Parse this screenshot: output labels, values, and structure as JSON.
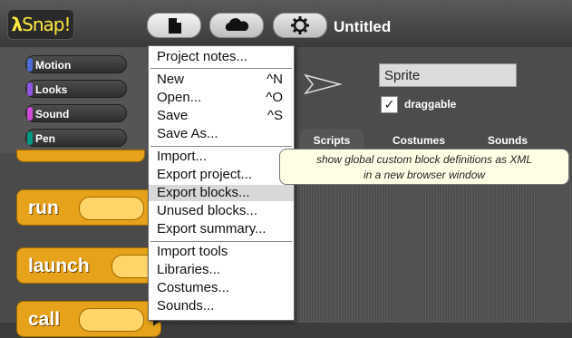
{
  "app": {
    "logo": "Snap!",
    "title": "Untitled"
  },
  "toolbar": {
    "file_icon": "file-icon",
    "cloud_icon": "cloud-icon",
    "settings_icon": "gear-icon"
  },
  "categories": [
    {
      "label": "Motion",
      "color": "#4a6cd4"
    },
    {
      "label": "Looks",
      "color": "#8f56e3"
    },
    {
      "label": "Sound",
      "color": "#cf4ad9"
    },
    {
      "label": "Pen",
      "color": "#009982"
    }
  ],
  "palette": {
    "blocks": [
      "run",
      "launch",
      "call"
    ]
  },
  "sprite": {
    "name": "Sprite",
    "draggable_label": "draggable",
    "draggable_checked": "✓"
  },
  "tabs": [
    "Scripts",
    "Costumes",
    "Sounds"
  ],
  "file_menu": {
    "items": [
      {
        "label": "Project notes...",
        "shortcut": ""
      },
      {
        "label": "New",
        "shortcut": "^N"
      },
      {
        "label": "Open...",
        "shortcut": "^O"
      },
      {
        "label": "Save",
        "shortcut": "^S"
      },
      {
        "label": "Save As...",
        "shortcut": ""
      },
      {
        "label": "Import...",
        "shortcut": ""
      },
      {
        "label": "Export project...",
        "shortcut": ""
      },
      {
        "label": "Export blocks...",
        "shortcut": ""
      },
      {
        "label": "Unused blocks...",
        "shortcut": ""
      },
      {
        "label": "Export summary...",
        "shortcut": ""
      },
      {
        "label": "Import tools",
        "shortcut": ""
      },
      {
        "label": "Libraries...",
        "shortcut": ""
      },
      {
        "label": "Costumes...",
        "shortcut": ""
      },
      {
        "label": "Sounds...",
        "shortcut": ""
      }
    ]
  },
  "tooltip": {
    "line1": "show global custom block definitions as XML",
    "line2": "in a new browser window"
  }
}
